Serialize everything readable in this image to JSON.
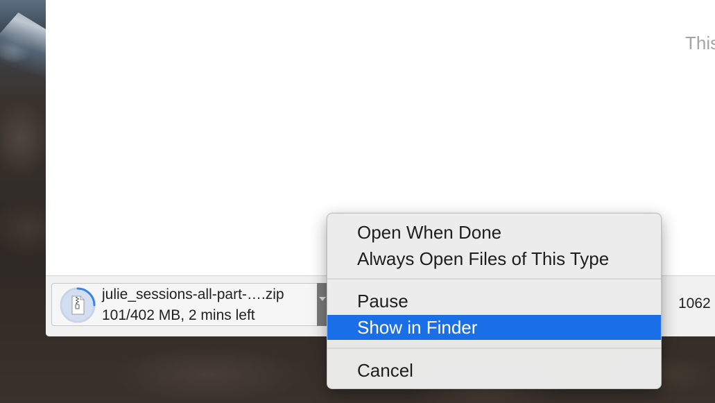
{
  "page": {
    "partial_text": "This"
  },
  "download_shelf": {
    "item": {
      "file_name": "julie_sessions-all-part-….zip",
      "status": "101/402 MB, 2 mins left",
      "progress_fraction": 0.25,
      "icon": "zip-file-icon"
    },
    "next_item_partial_text": "1062"
  },
  "context_menu": {
    "items": [
      {
        "label": "Open When Done",
        "highlighted": false
      },
      {
        "label": "Always Open Files of This Type",
        "highlighted": false
      },
      {
        "label": "Pause",
        "highlighted": false
      },
      {
        "label": "Show in Finder",
        "highlighted": true
      },
      {
        "label": "Cancel",
        "highlighted": false
      }
    ]
  },
  "colors": {
    "highlight": "#1a6fe8",
    "progress": "#3b82e6"
  }
}
